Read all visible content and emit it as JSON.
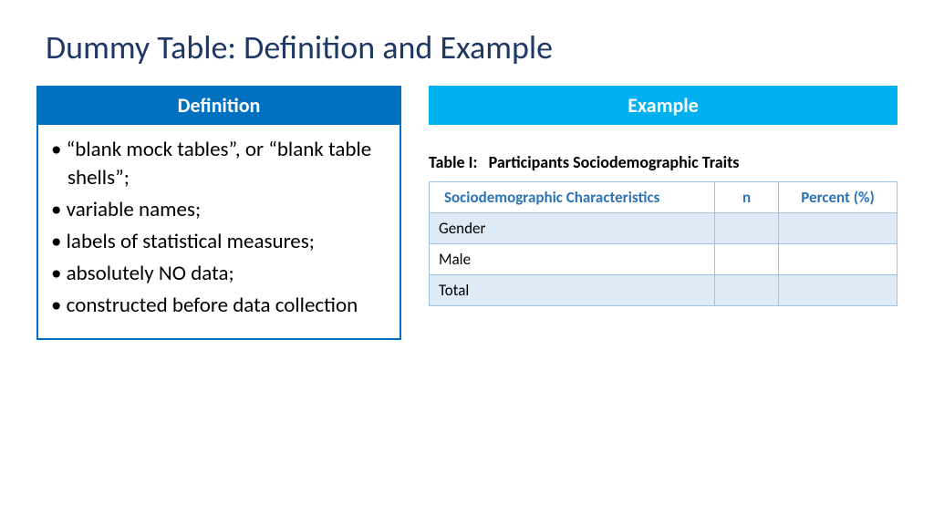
{
  "title": "Dummy Table: Definition and Example",
  "definition": {
    "header": "Definition",
    "items": [
      "“blank mock tables”, or “blank table shells”;",
      "variable names;",
      " labels of statistical measures;",
      "absolutely NO data;",
      " constructed before data collection"
    ]
  },
  "example": {
    "header": "Example",
    "table_title": "Table I:   Participants Sociodemographic Traits",
    "columns": {
      "c0": "Sociodemographic Characteristics",
      "c1": "n",
      "c2": "Percent (%)"
    },
    "rows": [
      {
        "label": "Gender",
        "n": "",
        "pct": "",
        "shaded": true
      },
      {
        "label": "Male",
        "n": "",
        "pct": "",
        "shaded": false
      },
      {
        "label": "Total",
        "n": "",
        "pct": "",
        "shaded": true
      }
    ]
  }
}
